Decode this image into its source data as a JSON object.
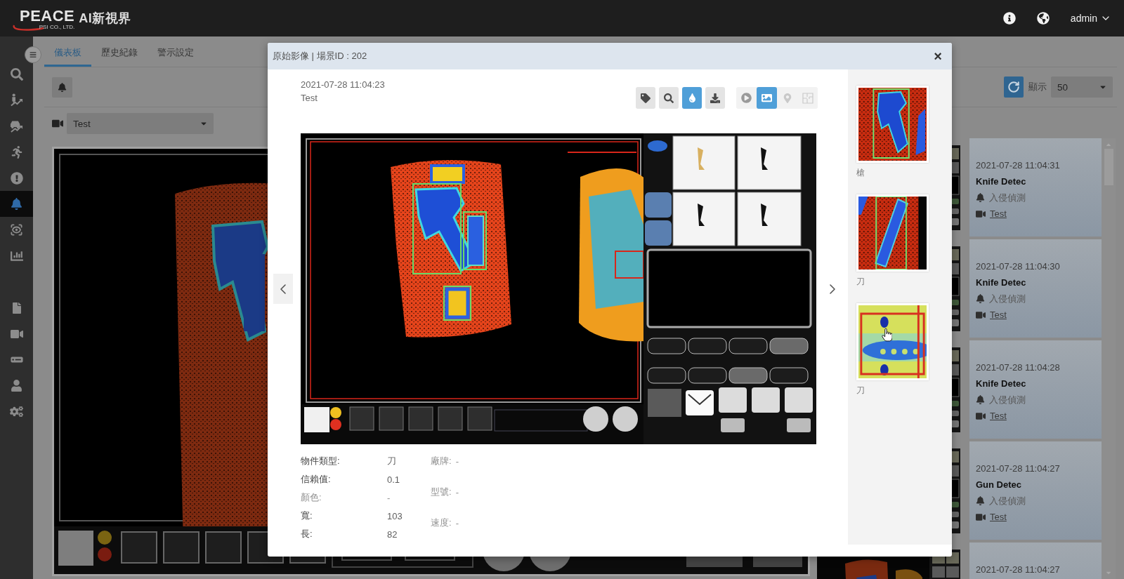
{
  "header": {
    "brand": "PEACE",
    "company": "PSI CO., LTD.",
    "product": "AI新視界",
    "user": "admin"
  },
  "sidebar": {
    "top_items": [
      {
        "selected": false
      },
      {
        "selected": false
      },
      {
        "selected": false
      },
      {
        "selected": false
      },
      {
        "selected": false
      },
      {
        "selected": true
      },
      {
        "selected": false
      },
      {
        "selected": false
      }
    ],
    "bottom_items": [
      {
        "selected": false
      },
      {
        "selected": false
      },
      {
        "selected": false
      },
      {
        "selected": false
      },
      {
        "selected": false
      }
    ]
  },
  "tabs": [
    {
      "label": "儀表板",
      "selected": true
    },
    {
      "label": "歷史紀錄",
      "selected": false
    },
    {
      "label": "警示設定",
      "selected": false
    }
  ],
  "dashboard": {
    "camera": "Test",
    "display_label": "顯示",
    "page_size": "50",
    "alerts": [
      {
        "time": "2021-07-28 11:04:31",
        "title": "Knife Detec",
        "type": "入侵偵測",
        "camera": "Test"
      },
      {
        "time": "2021-07-28 11:04:30",
        "title": "Knife Detec",
        "type": "入侵偵測",
        "camera": "Test"
      },
      {
        "time": "2021-07-28 11:04:28",
        "title": "Knife Detec",
        "type": "入侵偵測",
        "camera": "Test"
      },
      {
        "time": "2021-07-28 11:04:27",
        "title": "Gun Detec",
        "type": "入侵偵測",
        "camera": "Test"
      },
      {
        "time": "2021-07-28 11:04:27"
      }
    ]
  },
  "modal": {
    "title": "原始影像 | 場景ID : 202",
    "close": "×",
    "timestamp": "2021-07-28 11:04:23",
    "camera": "Test",
    "tool_groups": [
      {
        "tools": [
          {
            "selected": false,
            "disabled": false
          },
          {
            "selected": false,
            "disabled": false
          },
          {
            "selected": true,
            "disabled": false
          },
          {
            "selected": false,
            "disabled": false
          }
        ]
      },
      {
        "tools": [
          {
            "selected": false,
            "disabled": false
          },
          {
            "selected": true,
            "disabled": false
          },
          {
            "selected": false,
            "disabled": true
          },
          {
            "selected": false,
            "disabled": true
          }
        ]
      }
    ],
    "nav": {
      "prev": {
        "hovered": true
      },
      "next": {
        "hovered": false
      }
    },
    "details": [
      {
        "label": "物件類型:",
        "value": "刀",
        "disabled": false
      },
      {
        "label": "信賴值:",
        "value": "0.1",
        "disabled": false
      },
      {
        "label": "顏色:",
        "value": "-",
        "disabled": true
      },
      {
        "label": "寬:",
        "value": "103",
        "disabled": false
      },
      {
        "label": "長:",
        "value": "82",
        "disabled": false
      }
    ],
    "extra_details": [
      {
        "label": "廠牌:",
        "value": "-",
        "disabled": true
      },
      {
        "label": "型號:",
        "value": "-",
        "disabled": true
      },
      {
        "label": "速度:",
        "value": "-",
        "disabled": true
      }
    ],
    "thumbnails": [
      {
        "label": "槍"
      },
      {
        "label": "刀"
      },
      {
        "label": "刀"
      }
    ]
  }
}
